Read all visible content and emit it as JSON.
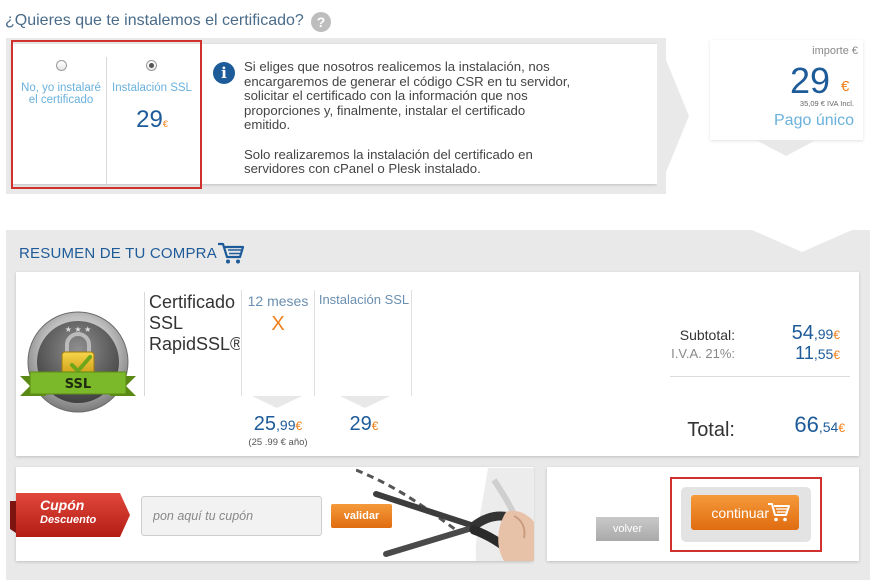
{
  "install_question": {
    "title": "¿Quieres que te instalemos el certificado?",
    "help_icon": "?",
    "options": [
      {
        "label": "No, yo instalaré el certificado",
        "selected": false
      },
      {
        "label": "Instalación SSL",
        "selected": true,
        "price": "29",
        "currency": "€"
      }
    ],
    "info_icon": "i",
    "info_paragraph_1": "Si eliges que nosotros realicemos la instalación, nos encargaremos de generar el código CSR en tu servidor, solicitar el certificado con la información que nos proporciones y, finalmente, instalar el certificado emitido.",
    "info_paragraph_2": "Solo realizaremos la instalación del certificado en servidores con cPanel o Plesk instalado."
  },
  "price_card": {
    "label": "importe €",
    "price": "29",
    "currency": "€",
    "iva_incl": "35,09 € IVA Incl.",
    "payment": "Pago único"
  },
  "summary": {
    "title": "RESUMEN DE TU COMPRA",
    "badge_text": "SSL",
    "product_name": "Certificado SSL RapidSSL®",
    "period_col": {
      "label": "12 meses",
      "remove": "X",
      "price_int": "25",
      "price_dec": ",99",
      "currency": "€",
      "per_year": "(25 .99 € año)"
    },
    "install_col": {
      "label": "Instalación SSL",
      "price": "29",
      "currency": "€"
    },
    "subtotal": {
      "label": "Subtotal:",
      "int": "54",
      "dec": ",99",
      "currency": "€"
    },
    "iva": {
      "label": "I.V.A. 21%:",
      "int": "11",
      "dec": ",55",
      "currency": "€"
    },
    "total": {
      "label": "Total:",
      "int": "66",
      "dec": ",54",
      "currency": "€"
    }
  },
  "coupon": {
    "ribbon_title": "Cupón",
    "ribbon_subtitle": "Descuento",
    "placeholder": "pon aquí tu cupón",
    "validate_label": "validar"
  },
  "actions": {
    "back_label": "volver",
    "continue_label": "continuar"
  },
  "colors": {
    "brand_blue": "#1e5b99",
    "light_blue": "#6ab1dc",
    "accent_orange": "#f07f19",
    "highlight_red": "#d0312d",
    "panel_grey": "#e9e9e9"
  }
}
